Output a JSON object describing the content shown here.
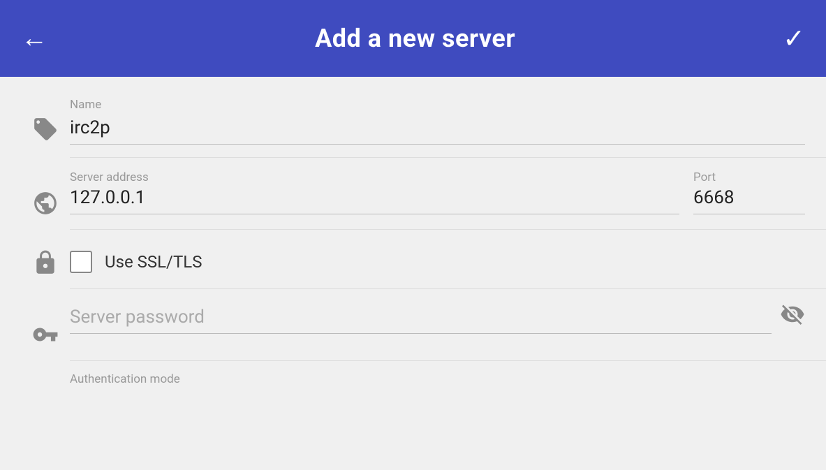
{
  "header": {
    "title": "Add a new server",
    "back_label": "←",
    "confirm_label": "✓"
  },
  "form": {
    "name_label": "Name",
    "name_value": "irc2p",
    "server_address_label": "Server address",
    "server_address_value": "127.0.0.1",
    "port_label": "Port",
    "port_value": "6668",
    "ssl_label": "Use SSL/TLS",
    "ssl_checked": false,
    "password_placeholder": "Server password",
    "password_value": "",
    "auth_mode_label": "Authentication mode"
  },
  "icons": {
    "back": "←",
    "confirm": "✓",
    "name_icon": "tag",
    "server_icon": "globe",
    "ssl_icon": "lock",
    "password_icon": "key"
  }
}
